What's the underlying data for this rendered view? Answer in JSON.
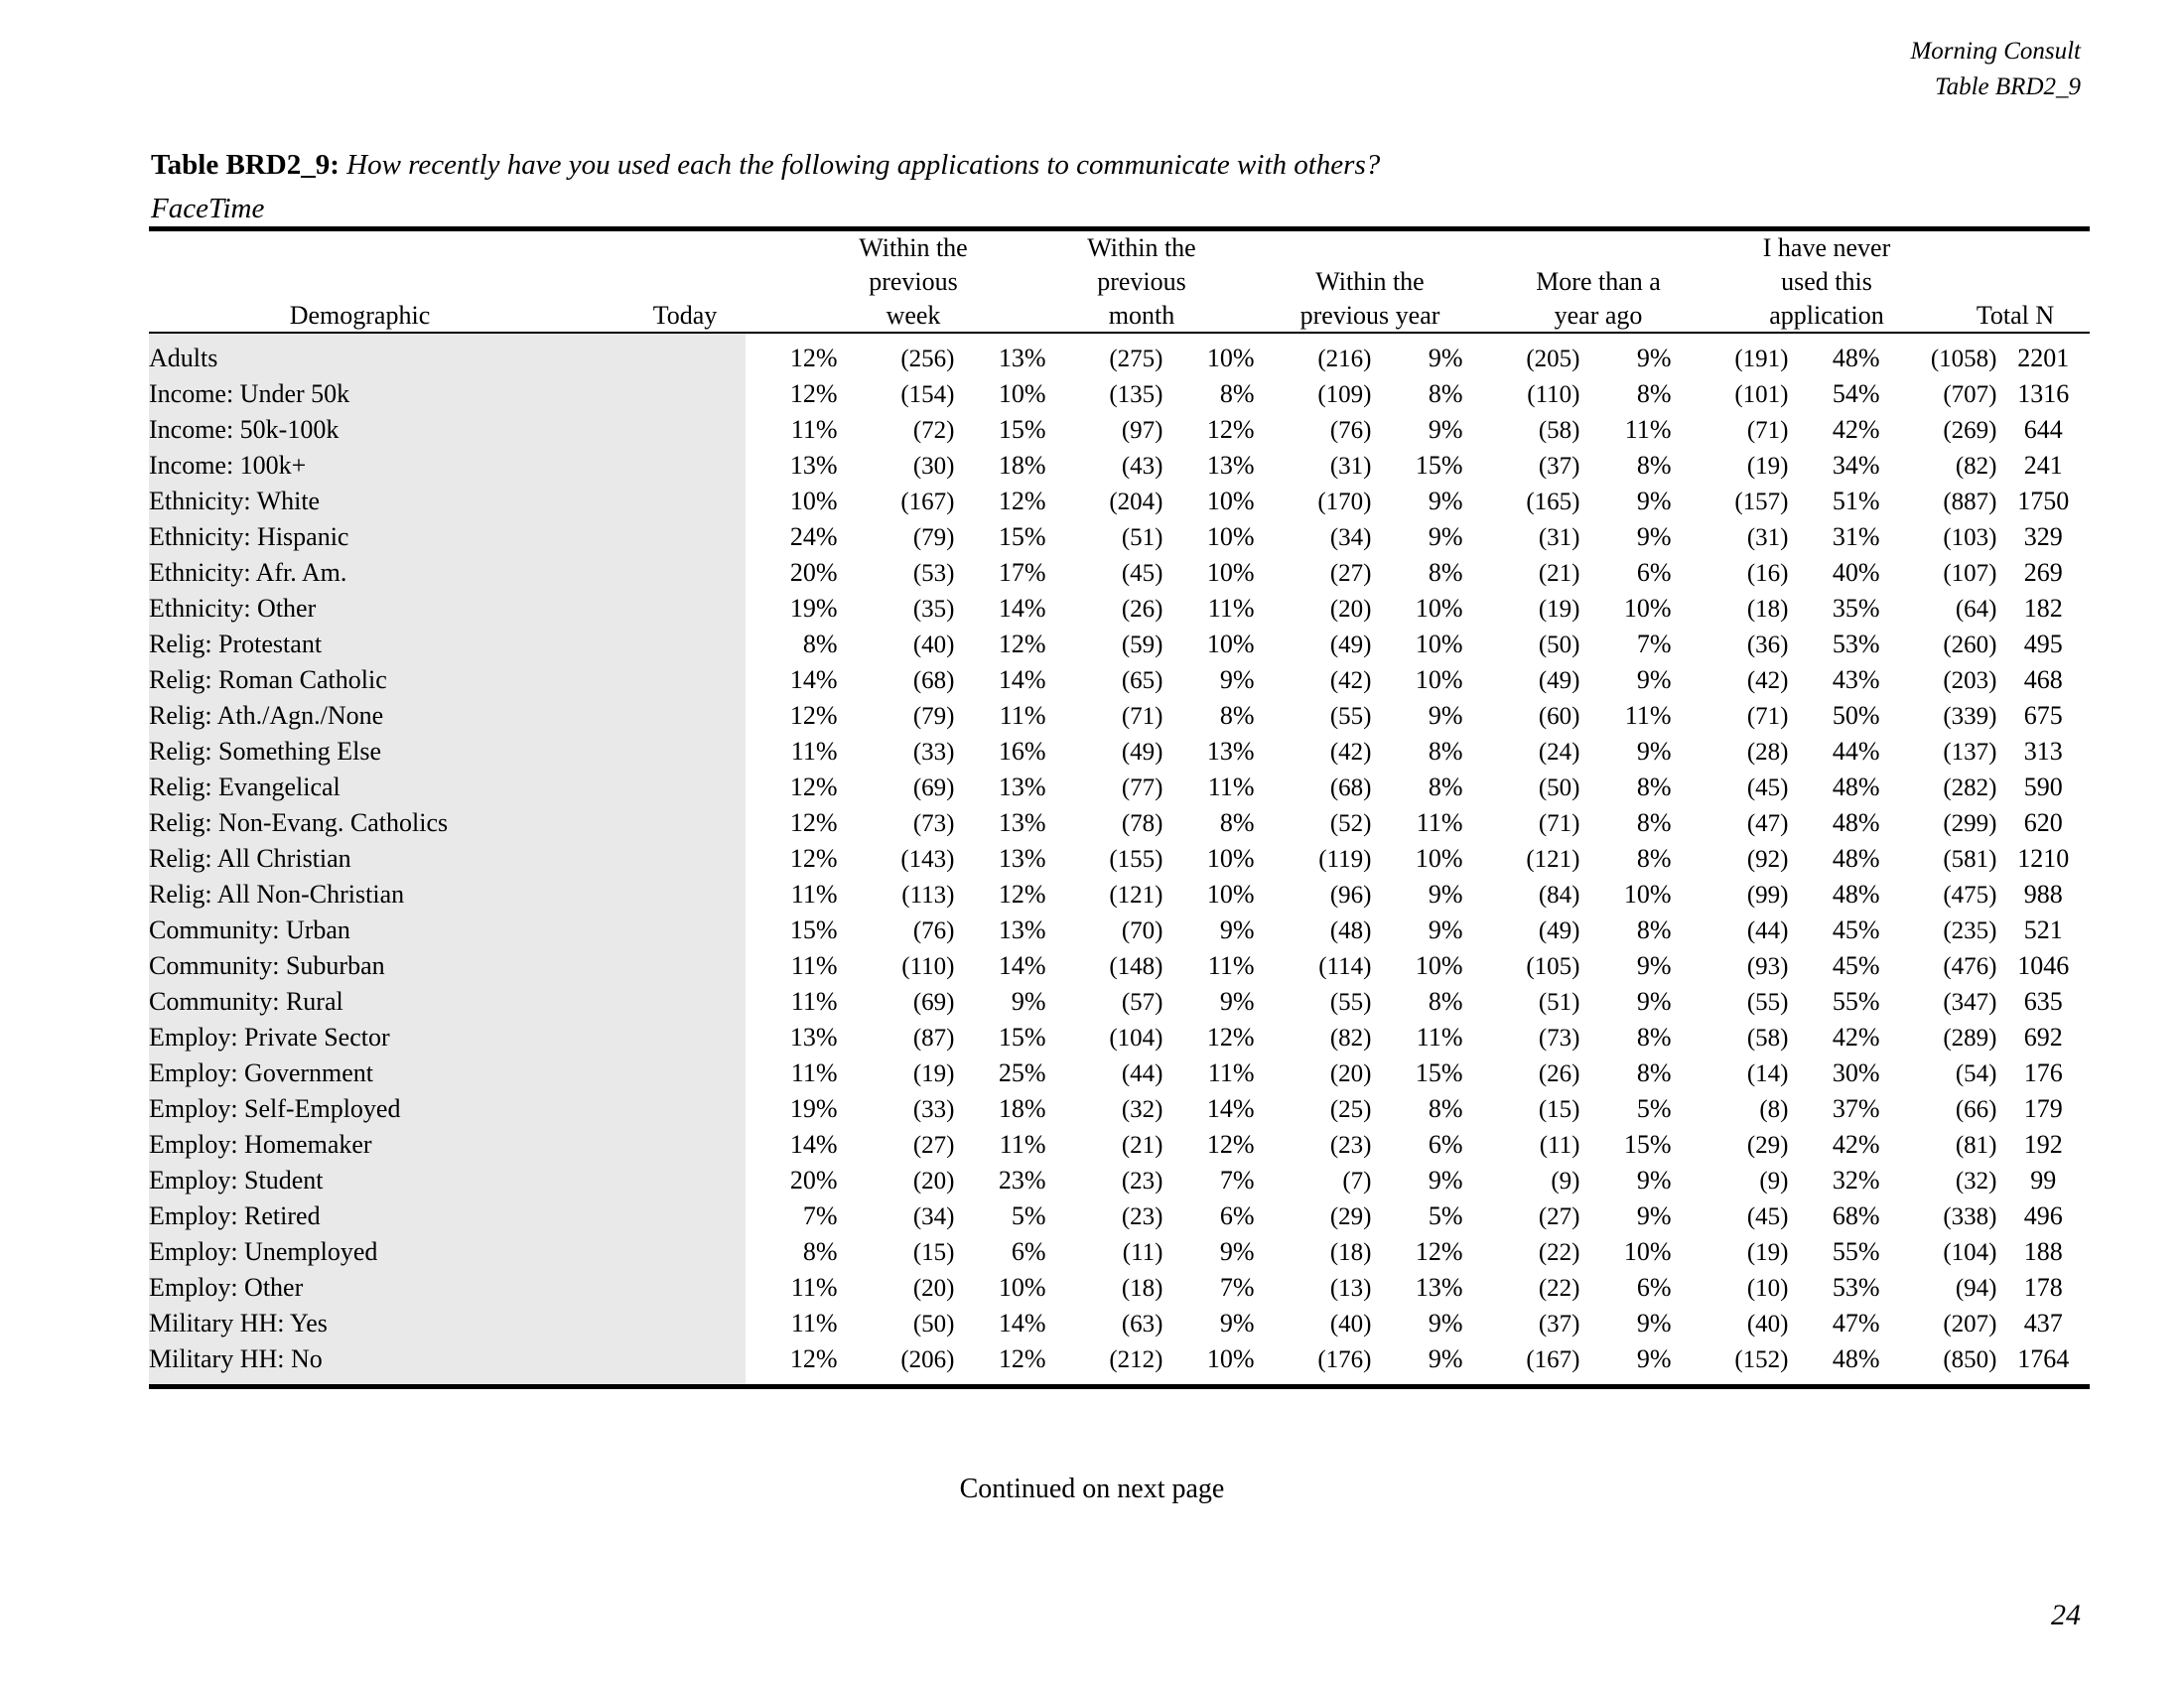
{
  "running_head": {
    "publisher": "Morning Consult",
    "table_id": "Table BRD2_9"
  },
  "title": {
    "label": "Table BRD2_9:",
    "question": "How recently have you used each the following applications to communicate with others?",
    "subtitle": "FaceTime"
  },
  "table": {
    "headers": {
      "demographic": "Demographic",
      "today": "Today",
      "within_previous_week": "Within the\nprevious\nweek",
      "within_previous_month": "Within the\nprevious\nmonth",
      "within_previous_year": "Within the\nprevious year",
      "more_than_a_year_ago": "More than a\nyear ago",
      "never_used": "I have never\nused this\napplication",
      "total_n": "Total N"
    },
    "rows": [
      {
        "demographic": "Adults",
        "today_pct": "12%",
        "today_n": "(256)",
        "week_pct": "13%",
        "week_n": "(275)",
        "month_pct": "10%",
        "month_n": "(216)",
        "year_pct": "9%",
        "year_n": "(205)",
        "more_pct": "9%",
        "more_n": "(191)",
        "never_pct": "48%",
        "never_n": "(1058)",
        "total_n": "2201"
      },
      {
        "demographic": "Income: Under 50k",
        "today_pct": "12%",
        "today_n": "(154)",
        "week_pct": "10%",
        "week_n": "(135)",
        "month_pct": "8%",
        "month_n": "(109)",
        "year_pct": "8%",
        "year_n": "(110)",
        "more_pct": "8%",
        "more_n": "(101)",
        "never_pct": "54%",
        "never_n": "(707)",
        "total_n": "1316"
      },
      {
        "demographic": "Income: 50k-100k",
        "today_pct": "11%",
        "today_n": "(72)",
        "week_pct": "15%",
        "week_n": "(97)",
        "month_pct": "12%",
        "month_n": "(76)",
        "year_pct": "9%",
        "year_n": "(58)",
        "more_pct": "11%",
        "more_n": "(71)",
        "never_pct": "42%",
        "never_n": "(269)",
        "total_n": "644"
      },
      {
        "demographic": "Income: 100k+",
        "today_pct": "13%",
        "today_n": "(30)",
        "week_pct": "18%",
        "week_n": "(43)",
        "month_pct": "13%",
        "month_n": "(31)",
        "year_pct": "15%",
        "year_n": "(37)",
        "more_pct": "8%",
        "more_n": "(19)",
        "never_pct": "34%",
        "never_n": "(82)",
        "total_n": "241"
      },
      {
        "demographic": "Ethnicity: White",
        "today_pct": "10%",
        "today_n": "(167)",
        "week_pct": "12%",
        "week_n": "(204)",
        "month_pct": "10%",
        "month_n": "(170)",
        "year_pct": "9%",
        "year_n": "(165)",
        "more_pct": "9%",
        "more_n": "(157)",
        "never_pct": "51%",
        "never_n": "(887)",
        "total_n": "1750"
      },
      {
        "demographic": "Ethnicity: Hispanic",
        "today_pct": "24%",
        "today_n": "(79)",
        "week_pct": "15%",
        "week_n": "(51)",
        "month_pct": "10%",
        "month_n": "(34)",
        "year_pct": "9%",
        "year_n": "(31)",
        "more_pct": "9%",
        "more_n": "(31)",
        "never_pct": "31%",
        "never_n": "(103)",
        "total_n": "329"
      },
      {
        "demographic": "Ethnicity: Afr. Am.",
        "today_pct": "20%",
        "today_n": "(53)",
        "week_pct": "17%",
        "week_n": "(45)",
        "month_pct": "10%",
        "month_n": "(27)",
        "year_pct": "8%",
        "year_n": "(21)",
        "more_pct": "6%",
        "more_n": "(16)",
        "never_pct": "40%",
        "never_n": "(107)",
        "total_n": "269"
      },
      {
        "demographic": "Ethnicity: Other",
        "today_pct": "19%",
        "today_n": "(35)",
        "week_pct": "14%",
        "week_n": "(26)",
        "month_pct": "11%",
        "month_n": "(20)",
        "year_pct": "10%",
        "year_n": "(19)",
        "more_pct": "10%",
        "more_n": "(18)",
        "never_pct": "35%",
        "never_n": "(64)",
        "total_n": "182"
      },
      {
        "demographic": "Relig: Protestant",
        "today_pct": "8%",
        "today_n": "(40)",
        "week_pct": "12%",
        "week_n": "(59)",
        "month_pct": "10%",
        "month_n": "(49)",
        "year_pct": "10%",
        "year_n": "(50)",
        "more_pct": "7%",
        "more_n": "(36)",
        "never_pct": "53%",
        "never_n": "(260)",
        "total_n": "495"
      },
      {
        "demographic": "Relig: Roman Catholic",
        "today_pct": "14%",
        "today_n": "(68)",
        "week_pct": "14%",
        "week_n": "(65)",
        "month_pct": "9%",
        "month_n": "(42)",
        "year_pct": "10%",
        "year_n": "(49)",
        "more_pct": "9%",
        "more_n": "(42)",
        "never_pct": "43%",
        "never_n": "(203)",
        "total_n": "468"
      },
      {
        "demographic": "Relig: Ath./Agn./None",
        "today_pct": "12%",
        "today_n": "(79)",
        "week_pct": "11%",
        "week_n": "(71)",
        "month_pct": "8%",
        "month_n": "(55)",
        "year_pct": "9%",
        "year_n": "(60)",
        "more_pct": "11%",
        "more_n": "(71)",
        "never_pct": "50%",
        "never_n": "(339)",
        "total_n": "675"
      },
      {
        "demographic": "Relig: Something Else",
        "today_pct": "11%",
        "today_n": "(33)",
        "week_pct": "16%",
        "week_n": "(49)",
        "month_pct": "13%",
        "month_n": "(42)",
        "year_pct": "8%",
        "year_n": "(24)",
        "more_pct": "9%",
        "more_n": "(28)",
        "never_pct": "44%",
        "never_n": "(137)",
        "total_n": "313"
      },
      {
        "demographic": "Relig: Evangelical",
        "today_pct": "12%",
        "today_n": "(69)",
        "week_pct": "13%",
        "week_n": "(77)",
        "month_pct": "11%",
        "month_n": "(68)",
        "year_pct": "8%",
        "year_n": "(50)",
        "more_pct": "8%",
        "more_n": "(45)",
        "never_pct": "48%",
        "never_n": "(282)",
        "total_n": "590"
      },
      {
        "demographic": "Relig: Non-Evang. Catholics",
        "today_pct": "12%",
        "today_n": "(73)",
        "week_pct": "13%",
        "week_n": "(78)",
        "month_pct": "8%",
        "month_n": "(52)",
        "year_pct": "11%",
        "year_n": "(71)",
        "more_pct": "8%",
        "more_n": "(47)",
        "never_pct": "48%",
        "never_n": "(299)",
        "total_n": "620"
      },
      {
        "demographic": "Relig: All Christian",
        "today_pct": "12%",
        "today_n": "(143)",
        "week_pct": "13%",
        "week_n": "(155)",
        "month_pct": "10%",
        "month_n": "(119)",
        "year_pct": "10%",
        "year_n": "(121)",
        "more_pct": "8%",
        "more_n": "(92)",
        "never_pct": "48%",
        "never_n": "(581)",
        "total_n": "1210"
      },
      {
        "demographic": "Relig: All Non-Christian",
        "today_pct": "11%",
        "today_n": "(113)",
        "week_pct": "12%",
        "week_n": "(121)",
        "month_pct": "10%",
        "month_n": "(96)",
        "year_pct": "9%",
        "year_n": "(84)",
        "more_pct": "10%",
        "more_n": "(99)",
        "never_pct": "48%",
        "never_n": "(475)",
        "total_n": "988"
      },
      {
        "demographic": "Community: Urban",
        "today_pct": "15%",
        "today_n": "(76)",
        "week_pct": "13%",
        "week_n": "(70)",
        "month_pct": "9%",
        "month_n": "(48)",
        "year_pct": "9%",
        "year_n": "(49)",
        "more_pct": "8%",
        "more_n": "(44)",
        "never_pct": "45%",
        "never_n": "(235)",
        "total_n": "521"
      },
      {
        "demographic": "Community: Suburban",
        "today_pct": "11%",
        "today_n": "(110)",
        "week_pct": "14%",
        "week_n": "(148)",
        "month_pct": "11%",
        "month_n": "(114)",
        "year_pct": "10%",
        "year_n": "(105)",
        "more_pct": "9%",
        "more_n": "(93)",
        "never_pct": "45%",
        "never_n": "(476)",
        "total_n": "1046"
      },
      {
        "demographic": "Community: Rural",
        "today_pct": "11%",
        "today_n": "(69)",
        "week_pct": "9%",
        "week_n": "(57)",
        "month_pct": "9%",
        "month_n": "(55)",
        "year_pct": "8%",
        "year_n": "(51)",
        "more_pct": "9%",
        "more_n": "(55)",
        "never_pct": "55%",
        "never_n": "(347)",
        "total_n": "635"
      },
      {
        "demographic": "Employ: Private Sector",
        "today_pct": "13%",
        "today_n": "(87)",
        "week_pct": "15%",
        "week_n": "(104)",
        "month_pct": "12%",
        "month_n": "(82)",
        "year_pct": "11%",
        "year_n": "(73)",
        "more_pct": "8%",
        "more_n": "(58)",
        "never_pct": "42%",
        "never_n": "(289)",
        "total_n": "692"
      },
      {
        "demographic": "Employ: Government",
        "today_pct": "11%",
        "today_n": "(19)",
        "week_pct": "25%",
        "week_n": "(44)",
        "month_pct": "11%",
        "month_n": "(20)",
        "year_pct": "15%",
        "year_n": "(26)",
        "more_pct": "8%",
        "more_n": "(14)",
        "never_pct": "30%",
        "never_n": "(54)",
        "total_n": "176"
      },
      {
        "demographic": "Employ: Self-Employed",
        "today_pct": "19%",
        "today_n": "(33)",
        "week_pct": "18%",
        "week_n": "(32)",
        "month_pct": "14%",
        "month_n": "(25)",
        "year_pct": "8%",
        "year_n": "(15)",
        "more_pct": "5%",
        "more_n": "(8)",
        "never_pct": "37%",
        "never_n": "(66)",
        "total_n": "179"
      },
      {
        "demographic": "Employ: Homemaker",
        "today_pct": "14%",
        "today_n": "(27)",
        "week_pct": "11%",
        "week_n": "(21)",
        "month_pct": "12%",
        "month_n": "(23)",
        "year_pct": "6%",
        "year_n": "(11)",
        "more_pct": "15%",
        "more_n": "(29)",
        "never_pct": "42%",
        "never_n": "(81)",
        "total_n": "192"
      },
      {
        "demographic": "Employ: Student",
        "today_pct": "20%",
        "today_n": "(20)",
        "week_pct": "23%",
        "week_n": "(23)",
        "month_pct": "7%",
        "month_n": "(7)",
        "year_pct": "9%",
        "year_n": "(9)",
        "more_pct": "9%",
        "more_n": "(9)",
        "never_pct": "32%",
        "never_n": "(32)",
        "total_n": "99"
      },
      {
        "demographic": "Employ: Retired",
        "today_pct": "7%",
        "today_n": "(34)",
        "week_pct": "5%",
        "week_n": "(23)",
        "month_pct": "6%",
        "month_n": "(29)",
        "year_pct": "5%",
        "year_n": "(27)",
        "more_pct": "9%",
        "more_n": "(45)",
        "never_pct": "68%",
        "never_n": "(338)",
        "total_n": "496"
      },
      {
        "demographic": "Employ: Unemployed",
        "today_pct": "8%",
        "today_n": "(15)",
        "week_pct": "6%",
        "week_n": "(11)",
        "month_pct": "9%",
        "month_n": "(18)",
        "year_pct": "12%",
        "year_n": "(22)",
        "more_pct": "10%",
        "more_n": "(19)",
        "never_pct": "55%",
        "never_n": "(104)",
        "total_n": "188"
      },
      {
        "demographic": "Employ: Other",
        "today_pct": "11%",
        "today_n": "(20)",
        "week_pct": "10%",
        "week_n": "(18)",
        "month_pct": "7%",
        "month_n": "(13)",
        "year_pct": "13%",
        "year_n": "(22)",
        "more_pct": "6%",
        "more_n": "(10)",
        "never_pct": "53%",
        "never_n": "(94)",
        "total_n": "178"
      },
      {
        "demographic": "Military HH: Yes",
        "today_pct": "11%",
        "today_n": "(50)",
        "week_pct": "14%",
        "week_n": "(63)",
        "month_pct": "9%",
        "month_n": "(40)",
        "year_pct": "9%",
        "year_n": "(37)",
        "more_pct": "9%",
        "more_n": "(40)",
        "never_pct": "47%",
        "never_n": "(207)",
        "total_n": "437"
      },
      {
        "demographic": "Military HH: No",
        "today_pct": "12%",
        "today_n": "(206)",
        "week_pct": "12%",
        "week_n": "(212)",
        "month_pct": "10%",
        "month_n": "(176)",
        "year_pct": "9%",
        "year_n": "(167)",
        "more_pct": "9%",
        "more_n": "(152)",
        "never_pct": "48%",
        "never_n": "(850)",
        "total_n": "1764"
      }
    ]
  },
  "footnote": "Continued on next page",
  "page_number": "24",
  "colors": {
    "shade": "#e9e9e9",
    "rule": "#000000",
    "text": "#000000"
  }
}
